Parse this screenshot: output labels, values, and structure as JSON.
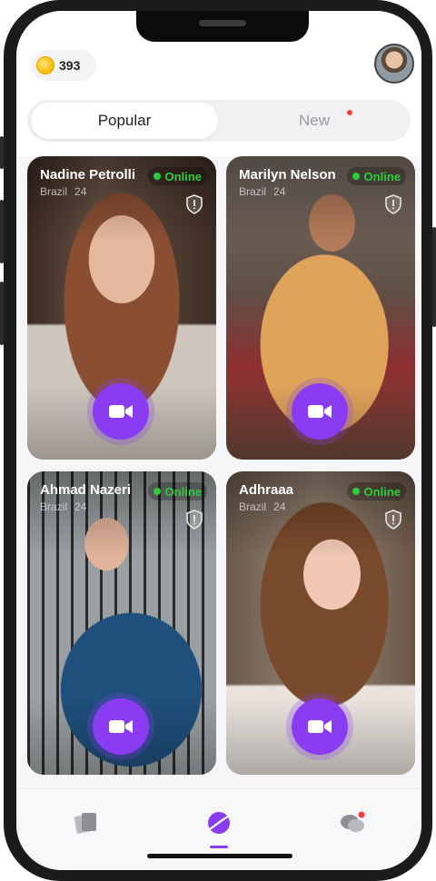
{
  "status": {
    "coins": "393"
  },
  "tabs": {
    "popular": "Popular",
    "new": "New"
  },
  "cards": [
    {
      "name": "Nadine Petrolli",
      "country": "Brazil",
      "age": "24",
      "status": "Online"
    },
    {
      "name": "Marilyn Nelson",
      "country": "Brazil",
      "age": "24",
      "status": "Online"
    },
    {
      "name": "Ahmad Nazeri",
      "country": "Brazil",
      "age": "24",
      "status": "Online"
    },
    {
      "name": "Adhraaa",
      "country": "Brazil",
      "age": "24",
      "status": "Online"
    }
  ],
  "nav": {
    "items": [
      "cards-icon",
      "discover-icon",
      "chat-icon"
    ],
    "active": "discover-icon"
  },
  "colors": {
    "accent": "#8a3cf2",
    "online": "#2ecc3c",
    "badge": "#ff3b3b",
    "coin": "#f5b800"
  }
}
